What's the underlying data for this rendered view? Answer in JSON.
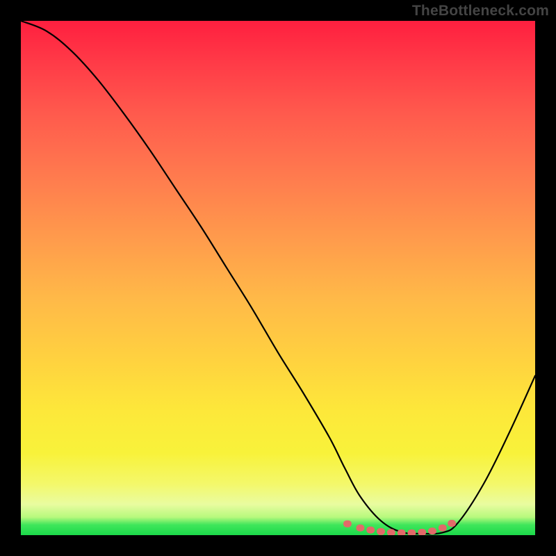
{
  "watermark": "TheBottleneck.com",
  "chart_data": {
    "type": "line",
    "title": "",
    "xlabel": "",
    "ylabel": "",
    "xlim": [
      0,
      100
    ],
    "ylim": [
      0,
      100
    ],
    "series": [
      {
        "name": "curve",
        "x": [
          0,
          5,
          10,
          15,
          20,
          25,
          30,
          35,
          40,
          45,
          50,
          55,
          60,
          63,
          66,
          70,
          74,
          78,
          82,
          85,
          90,
          95,
          100
        ],
        "y": [
          100,
          98,
          94,
          88.5,
          82,
          75,
          67.5,
          60,
          52,
          44,
          35.5,
          27.5,
          19,
          13,
          7.5,
          2.8,
          0.6,
          0.3,
          0.5,
          2.4,
          10,
          20,
          31
        ]
      },
      {
        "name": "highlight-dots",
        "x": [
          63.5,
          66,
          68,
          70,
          72,
          74,
          76,
          78,
          80,
          82,
          83.8
        ],
        "y": [
          2.2,
          1.4,
          1.0,
          0.7,
          0.5,
          0.45,
          0.45,
          0.55,
          0.8,
          1.4,
          2.3
        ]
      }
    ],
    "colors": {
      "curve": "#000000",
      "dots": "#e26a69",
      "gradient_top": "#ff1f3f",
      "gradient_mid1": "#ff9a4c",
      "gradient_mid2": "#fde83a",
      "gradient_bottom": "#1bd94a"
    }
  }
}
